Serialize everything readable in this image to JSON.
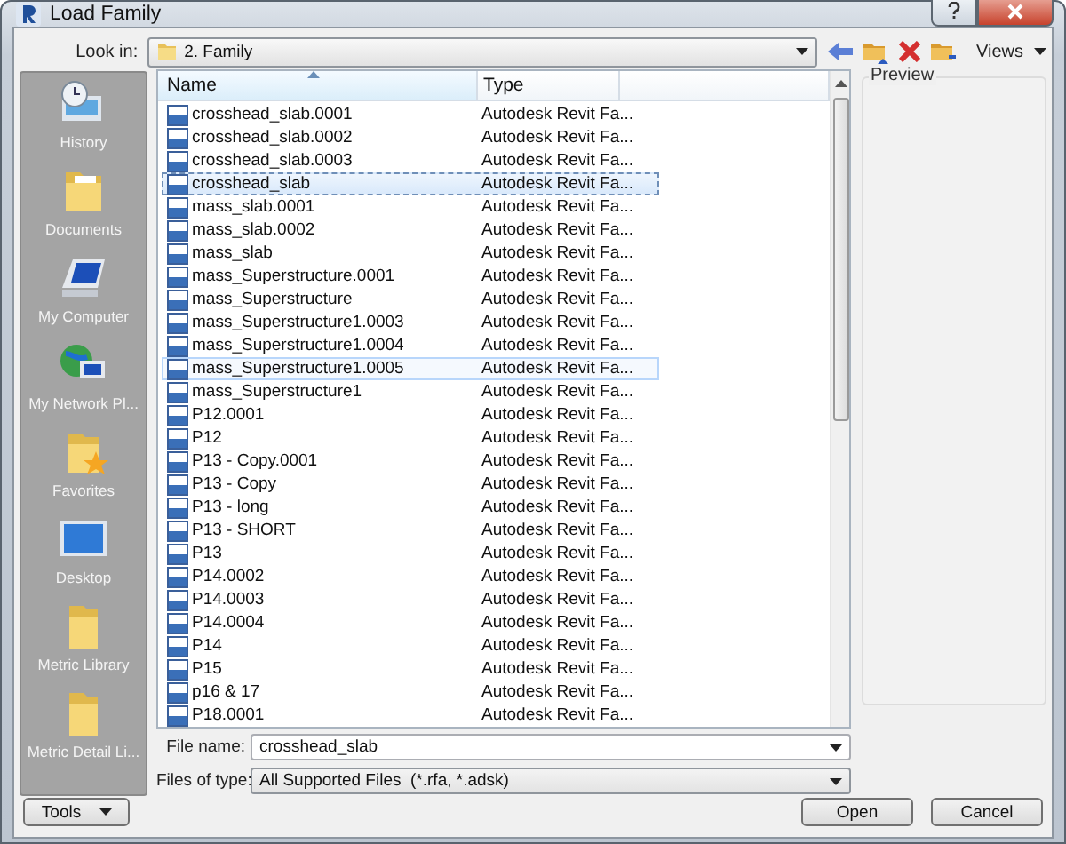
{
  "window": {
    "title": "Load Family"
  },
  "look_in": {
    "label": "Look in:",
    "value": "2. Family"
  },
  "toolbar": {
    "views": "Views"
  },
  "sidebar": {
    "items": [
      {
        "label": "History",
        "kind": "history"
      },
      {
        "label": "Documents",
        "kind": "documents"
      },
      {
        "label": "My Computer",
        "kind": "computer"
      },
      {
        "label": "My Network Pl...",
        "kind": "network"
      },
      {
        "label": "Favorites",
        "kind": "favorites"
      },
      {
        "label": "Desktop",
        "kind": "desktop"
      },
      {
        "label": "Metric Library",
        "kind": "folder"
      },
      {
        "label": "Metric Detail Li...",
        "kind": "folder"
      }
    ]
  },
  "file_list": {
    "columns": [
      "Name",
      "Type"
    ],
    "rows": [
      {
        "name": "crosshead_slab.0001",
        "type": "Autodesk Revit Fa...",
        "selected": false,
        "hovered": false
      },
      {
        "name": "crosshead_slab.0002",
        "type": "Autodesk Revit Fa...",
        "selected": false,
        "hovered": false
      },
      {
        "name": "crosshead_slab.0003",
        "type": "Autodesk Revit Fa...",
        "selected": false,
        "hovered": false
      },
      {
        "name": "crosshead_slab",
        "type": "Autodesk Revit Fa...",
        "selected": true,
        "hovered": false
      },
      {
        "name": "mass_slab.0001",
        "type": "Autodesk Revit Fa...",
        "selected": false,
        "hovered": false
      },
      {
        "name": "mass_slab.0002",
        "type": "Autodesk Revit Fa...",
        "selected": false,
        "hovered": false
      },
      {
        "name": "mass_slab",
        "type": "Autodesk Revit Fa...",
        "selected": false,
        "hovered": false
      },
      {
        "name": "mass_Superstructure.0001",
        "type": "Autodesk Revit Fa...",
        "selected": false,
        "hovered": false
      },
      {
        "name": "mass_Superstructure",
        "type": "Autodesk Revit Fa...",
        "selected": false,
        "hovered": false
      },
      {
        "name": "mass_Superstructure1.0003",
        "type": "Autodesk Revit Fa...",
        "selected": false,
        "hovered": false
      },
      {
        "name": "mass_Superstructure1.0004",
        "type": "Autodesk Revit Fa...",
        "selected": false,
        "hovered": false
      },
      {
        "name": "mass_Superstructure1.0005",
        "type": "Autodesk Revit Fa...",
        "selected": false,
        "hovered": true
      },
      {
        "name": "mass_Superstructure1",
        "type": "Autodesk Revit Fa...",
        "selected": false,
        "hovered": false
      },
      {
        "name": "P12.0001",
        "type": "Autodesk Revit Fa...",
        "selected": false,
        "hovered": false
      },
      {
        "name": "P12",
        "type": "Autodesk Revit Fa...",
        "selected": false,
        "hovered": false
      },
      {
        "name": "P13 - Copy.0001",
        "type": "Autodesk Revit Fa...",
        "selected": false,
        "hovered": false
      },
      {
        "name": "P13 - Copy",
        "type": "Autodesk Revit Fa...",
        "selected": false,
        "hovered": false
      },
      {
        "name": "P13 - long",
        "type": "Autodesk Revit Fa...",
        "selected": false,
        "hovered": false
      },
      {
        "name": "P13 - SHORT",
        "type": "Autodesk Revit Fa...",
        "selected": false,
        "hovered": false
      },
      {
        "name": "P13",
        "type": "Autodesk Revit Fa...",
        "selected": false,
        "hovered": false
      },
      {
        "name": "P14.0002",
        "type": "Autodesk Revit Fa...",
        "selected": false,
        "hovered": false
      },
      {
        "name": "P14.0003",
        "type": "Autodesk Revit Fa...",
        "selected": false,
        "hovered": false
      },
      {
        "name": "P14.0004",
        "type": "Autodesk Revit Fa...",
        "selected": false,
        "hovered": false
      },
      {
        "name": "P14",
        "type": "Autodesk Revit Fa...",
        "selected": false,
        "hovered": false
      },
      {
        "name": "P15",
        "type": "Autodesk Revit Fa...",
        "selected": false,
        "hovered": false
      },
      {
        "name": "p16 & 17",
        "type": "Autodesk Revit Fa...",
        "selected": false,
        "hovered": false
      },
      {
        "name": "P18.0001",
        "type": "Autodesk Revit Fa...",
        "selected": false,
        "hovered": false
      }
    ]
  },
  "preview": {
    "label": "Preview"
  },
  "file_name": {
    "label": "File name:",
    "value": "crosshead_slab"
  },
  "files_of_type": {
    "label": "Files of type:",
    "value": "All Supported Files  (*.rfa, *.adsk)"
  },
  "buttons": {
    "tools": "Tools",
    "open": "Open",
    "cancel": "Cancel"
  }
}
